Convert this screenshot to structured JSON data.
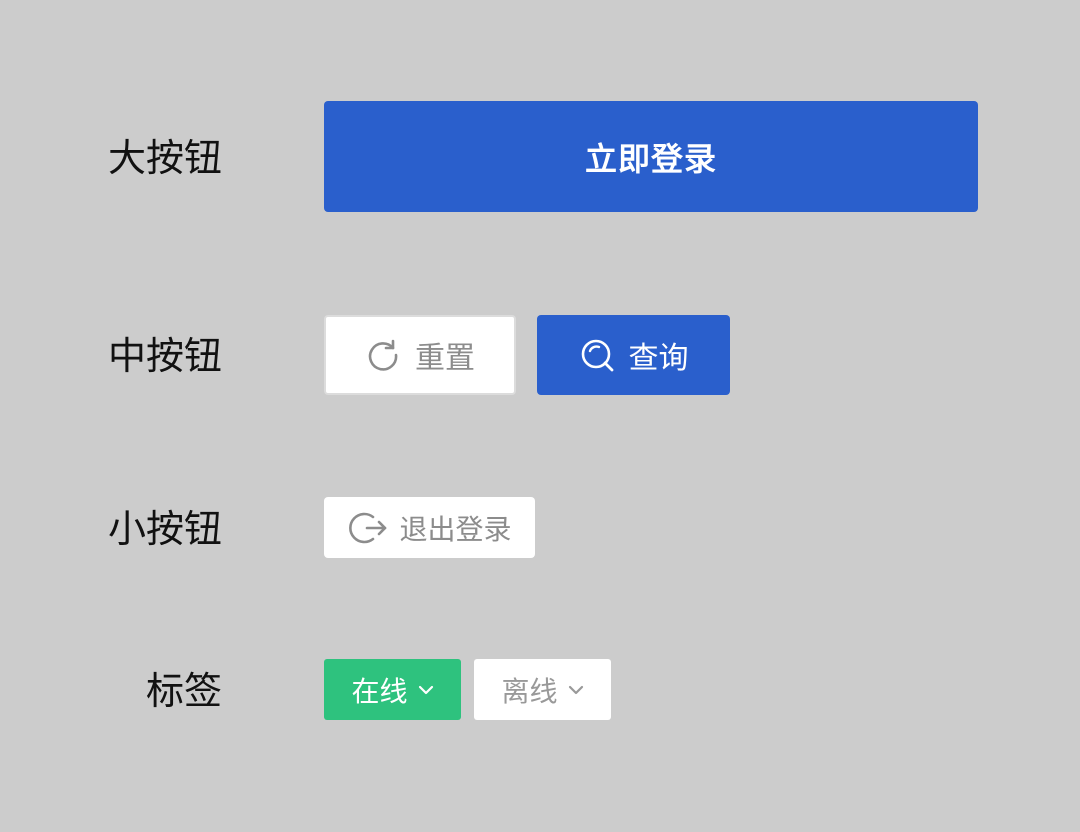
{
  "rows": {
    "large": {
      "label": "大按钮",
      "login_button": {
        "label": "立即登录"
      }
    },
    "medium": {
      "label": "中按钮",
      "reset_button": {
        "label": "重置",
        "icon": "refresh-icon"
      },
      "query_button": {
        "label": "查询",
        "icon": "search-icon"
      }
    },
    "small": {
      "label": "小按钮",
      "logout_button": {
        "label": "退出登录",
        "icon": "logout-icon"
      }
    },
    "tags": {
      "label": "标签",
      "online_tag": {
        "label": "在线",
        "icon": "chevron-down-icon"
      },
      "offline_tag": {
        "label": "离线",
        "icon": "chevron-down-icon"
      }
    }
  },
  "colors": {
    "background": "#cccccc",
    "primary": "#2a5fcc",
    "success": "#2ec27e",
    "muted_text": "#8c8c8c",
    "white": "#ffffff"
  }
}
